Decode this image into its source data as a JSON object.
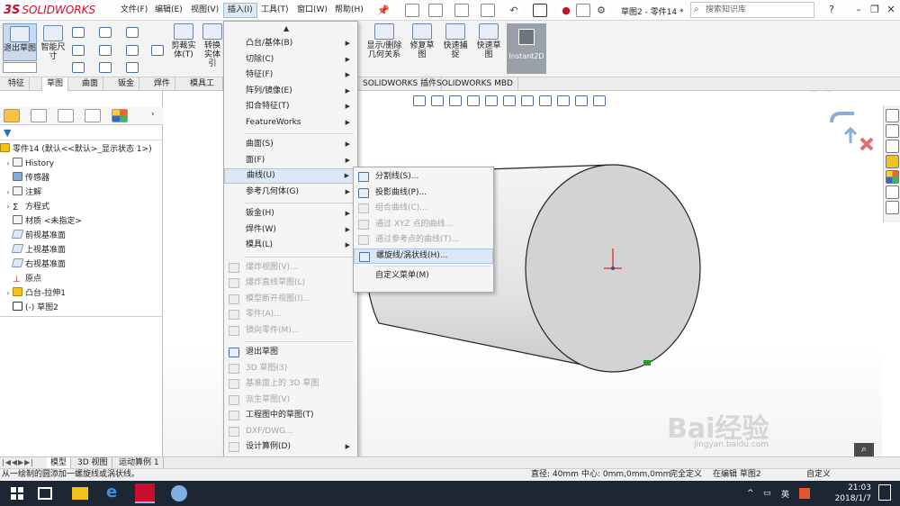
{
  "app": {
    "logo_prefix": "3S",
    "logo_name": "SOLIDWORKS",
    "doc_title": "草图2 - 零件14 *",
    "search_placeholder": "搜索知识库"
  },
  "menubar": [
    "文件(F)",
    "编辑(E)",
    "视图(V)",
    "插入(I)",
    "工具(T)",
    "窗口(W)",
    "帮助(H)"
  ],
  "ribbon": {
    "exit_sketch": "退出草图",
    "smart_dim": "智能尺寸",
    "trim": "剪裁实体(T)",
    "convert": "转换实体引",
    "show_relations": "显示/删除几何关系",
    "repair_sketch": "修复草图",
    "quick_snap": "快速捕捉",
    "quick_sketch": "快速草图",
    "instant2d": "Instant2D"
  },
  "tabs": [
    "特征",
    "草图",
    "曲面",
    "钣金",
    "焊件",
    "模具工具",
    "SOLIDWORKS 插件",
    "SOLIDWORKS MBD"
  ],
  "tree": {
    "root": "零件14 (默认<<默认>_显示状态 1>)",
    "items": [
      "History",
      "传感器",
      "注解",
      "方程式",
      "材质 <未指定>",
      "前视基准面",
      "上视基准面",
      "右视基准面",
      "原点",
      "凸台-拉伸1",
      "(-) 草图2"
    ]
  },
  "insert_menu": {
    "items": [
      {
        "label": "凸台/基体(B)",
        "sub": true,
        "dis": false
      },
      {
        "label": "切除(C)",
        "sub": true,
        "dis": false
      },
      {
        "label": "特征(F)",
        "sub": true,
        "dis": false
      },
      {
        "label": "阵列/镜像(E)",
        "sub": true,
        "dis": false
      },
      {
        "label": "扣合特征(T)",
        "sub": true,
        "dis": false
      },
      {
        "label": "FeatureWorks",
        "sub": true,
        "dis": false
      },
      {
        "label": "曲面(S)",
        "sub": true,
        "dis": false
      },
      {
        "label": "面(F)",
        "sub": true,
        "dis": false
      },
      {
        "label": "曲线(U)",
        "sub": true,
        "dis": false
      },
      {
        "label": "参考几何体(G)",
        "sub": true,
        "dis": false
      },
      {
        "label": "钣金(H)",
        "sub": true,
        "dis": false
      },
      {
        "label": "焊件(W)",
        "sub": true,
        "dis": false
      },
      {
        "label": "模具(L)",
        "sub": true,
        "dis": false
      },
      {
        "label": "爆炸视图(V)...",
        "sub": false,
        "dis": true
      },
      {
        "label": "爆炸直线草图(L)",
        "sub": false,
        "dis": true
      },
      {
        "label": "模型断开视图(I)...",
        "sub": false,
        "dis": true
      },
      {
        "label": "零件(A)...",
        "sub": false,
        "dis": true
      },
      {
        "label": "镜向零件(M)...",
        "sub": false,
        "dis": true
      },
      {
        "label": "退出草图",
        "sub": false,
        "dis": false
      },
      {
        "label": "3D 草图(3)",
        "sub": false,
        "dis": true
      },
      {
        "label": "基准面上的 3D 草图",
        "sub": false,
        "dis": true
      },
      {
        "label": "派生草图(V)",
        "sub": false,
        "dis": true
      },
      {
        "label": "工程图中的草图(T)",
        "sub": false,
        "dis": false
      },
      {
        "label": "DXF/DWG...",
        "sub": false,
        "dis": true
      },
      {
        "label": "设计算例(D)",
        "sub": true,
        "dis": false
      }
    ]
  },
  "curve_menu": {
    "items": [
      {
        "label": "分割线(S)...",
        "dis": false
      },
      {
        "label": "投影曲线(P)...",
        "dis": false
      },
      {
        "label": "组合曲线(C)...",
        "dis": true
      },
      {
        "label": "通过 XYZ 点的曲线...",
        "dis": true
      },
      {
        "label": "通过参考点的曲线(T)...",
        "dis": true
      },
      {
        "label": "螺旋线/涡状线(H)...",
        "dis": false
      },
      {
        "label": "自定义菜单(M)",
        "dis": false
      }
    ]
  },
  "bottom_tabs": [
    "模型",
    "3D 视图",
    "运动算例 1"
  ],
  "status": {
    "hint": "从一绘制的圆添加一螺旋线或涡状线。",
    "diameter": "直径: 40mm",
    "center": "中心: 0mm,0mm,0mm",
    "defined": "完全定义",
    "editing": "在编辑 草图2",
    "custom": "自定义",
    "lang": "英"
  },
  "clock": {
    "time": "21:03",
    "date": "2018/1/7"
  },
  "watermark": {
    "text": "Bai经验",
    "url": "jingyan.baidu.com"
  },
  "colors": {
    "accent": "#c8102e",
    "highlight": "#dce8f6",
    "instant2d": "#9aa0a8"
  }
}
